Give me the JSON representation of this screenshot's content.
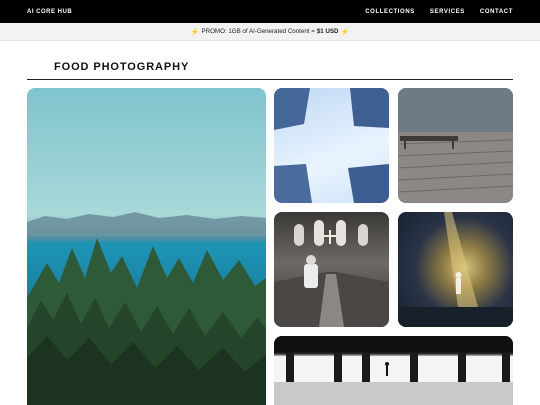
{
  "header": {
    "brand": "AI CORE HUB",
    "nav": [
      "COLLECTIONS",
      "SERVICES",
      "CONTACT"
    ]
  },
  "promo": {
    "prefix": "PROMO: 1GB of AI-Generated Content = ",
    "price": "$1 USD",
    "icon": "lightning-bolt-icon"
  },
  "gallery": {
    "title": "FOOD PHOTOGRAPHY",
    "images": [
      "coastal-forest-photo",
      "sky-architecture-photo",
      "waterfront-boardwalk-photo",
      "church-interior-photo",
      "spotlit-wall-photo",
      "subway-platform-photo"
    ]
  },
  "colors": {
    "topbar": "#000000",
    "promo_bg": "#f2f2f2",
    "bolt": "#f2b705"
  }
}
